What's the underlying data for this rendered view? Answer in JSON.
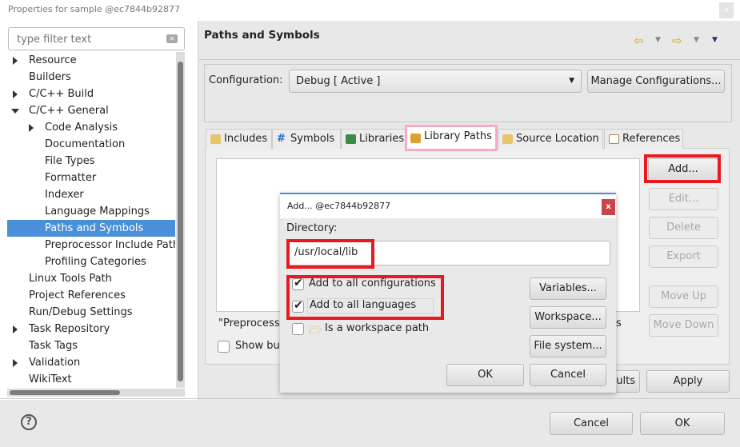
{
  "window": {
    "title": "Properties for sample @ec7844b92877",
    "close": "x"
  },
  "filter": {
    "placeholder": "type filter text"
  },
  "tree": [
    {
      "label": "Resource",
      "level": 0,
      "expandable": true
    },
    {
      "label": "Builders",
      "level": 0,
      "expandable": false
    },
    {
      "label": "C/C++ Build",
      "level": 0,
      "expandable": true
    },
    {
      "label": "C/C++ General",
      "level": 0,
      "expandable": true,
      "expanded": true
    },
    {
      "label": "Code Analysis",
      "level": 1,
      "expandable": true
    },
    {
      "label": "Documentation",
      "level": 1,
      "expandable": false
    },
    {
      "label": "File Types",
      "level": 1,
      "expandable": false
    },
    {
      "label": "Formatter",
      "level": 1,
      "expandable": false
    },
    {
      "label": "Indexer",
      "level": 1,
      "expandable": false
    },
    {
      "label": "Language Mappings",
      "level": 1,
      "expandable": false
    },
    {
      "label": "Paths and Symbols",
      "level": 1,
      "expandable": false,
      "selected": true
    },
    {
      "label": "Preprocessor Include Paths",
      "level": 1,
      "expandable": false
    },
    {
      "label": "Profiling Categories",
      "level": 1,
      "expandable": false
    },
    {
      "label": "Linux Tools Path",
      "level": 0,
      "expandable": false
    },
    {
      "label": "Project References",
      "level": 0,
      "expandable": false
    },
    {
      "label": "Run/Debug Settings",
      "level": 0,
      "expandable": false
    },
    {
      "label": "Task Repository",
      "level": 0,
      "expandable": true
    },
    {
      "label": "Task Tags",
      "level": 0,
      "expandable": false
    },
    {
      "label": "Validation",
      "level": 0,
      "expandable": true
    },
    {
      "label": "WikiText",
      "level": 0,
      "expandable": false
    }
  ],
  "page": {
    "title": "Paths and Symbols",
    "config_label": "Configuration:",
    "config_value": "Debug  [ Active ]",
    "manage": "Manage Configurations..."
  },
  "tabs": [
    {
      "label": "Includes"
    },
    {
      "label": "Symbols"
    },
    {
      "label": "Libraries"
    },
    {
      "label": "Library Paths",
      "active": true
    },
    {
      "label": "Source Location"
    },
    {
      "label": "References"
    }
  ],
  "side_buttons": {
    "add": "Add...",
    "edit": "Edit...",
    "delete": "Delete",
    "export": "Export",
    "move_up": "Move Up",
    "move_down": "Move Down"
  },
  "panel": {
    "note_partial": "\"Preprocesso",
    "note_tail": "s",
    "show_builtin_partial": "Show bui"
  },
  "footer": {
    "restore_partial": "ults",
    "apply": "Apply",
    "cancel": "Cancel",
    "ok": "OK"
  },
  "dialog": {
    "title": "Add... @ec7844b92877",
    "close": "x",
    "dir_label": "Directory:",
    "dir_value": "/usr/local/lib",
    "cb_all_configs": "Add to all configurations",
    "cb_all_langs": "Add to all languages",
    "cb_workspace": "Is a workspace path",
    "variables": "Variables...",
    "workspace": "Workspace...",
    "filesystem": "File system...",
    "ok": "OK",
    "cancel": "Cancel"
  },
  "colors": {
    "selection": "#4a90d9",
    "highlight_red": "#e8191f",
    "highlight_pink": "#f9a8c8"
  }
}
